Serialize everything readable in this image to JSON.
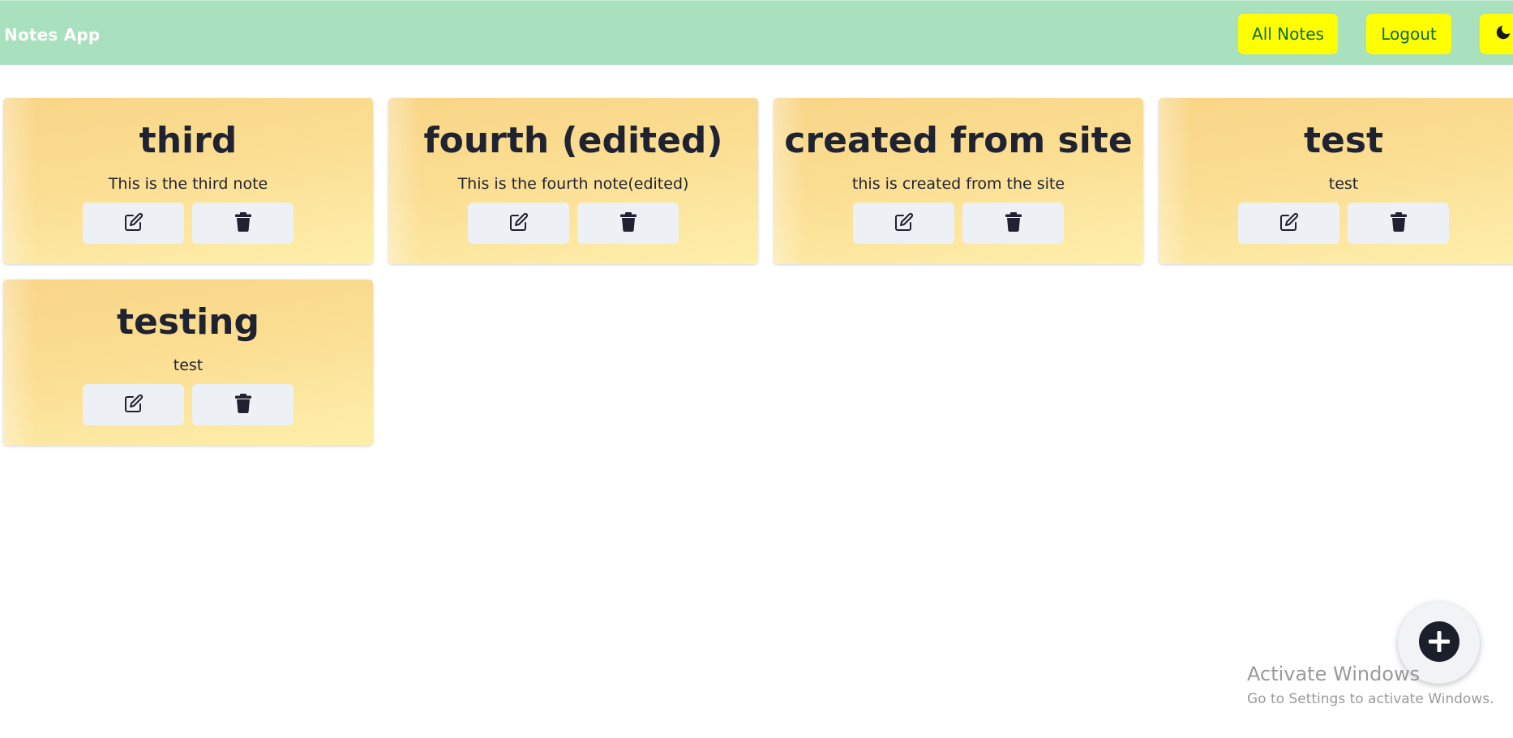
{
  "navbar": {
    "brand": "Notes App",
    "all_notes_label": "All Notes",
    "logout_label": "Logout",
    "theme_icon": "moon-icon",
    "background": "#a9e0bd",
    "button_color": "#ffff00"
  },
  "notes": [
    {
      "title": "third",
      "body": "This is the third note"
    },
    {
      "title": "fourth (edited)",
      "body": "This is the fourth note(edited)"
    },
    {
      "title": "created from site",
      "body": "this is created from the site"
    },
    {
      "title": "test",
      "body": "test"
    },
    {
      "title": "testing",
      "body": "test"
    }
  ],
  "note_actions": {
    "edit_icon": "edit-icon",
    "delete_icon": "trash-icon"
  },
  "fab": {
    "icon": "plus-circle-icon"
  },
  "watermark": {
    "title": "Activate Windows",
    "subtitle": "Go to Settings to activate Windows."
  }
}
